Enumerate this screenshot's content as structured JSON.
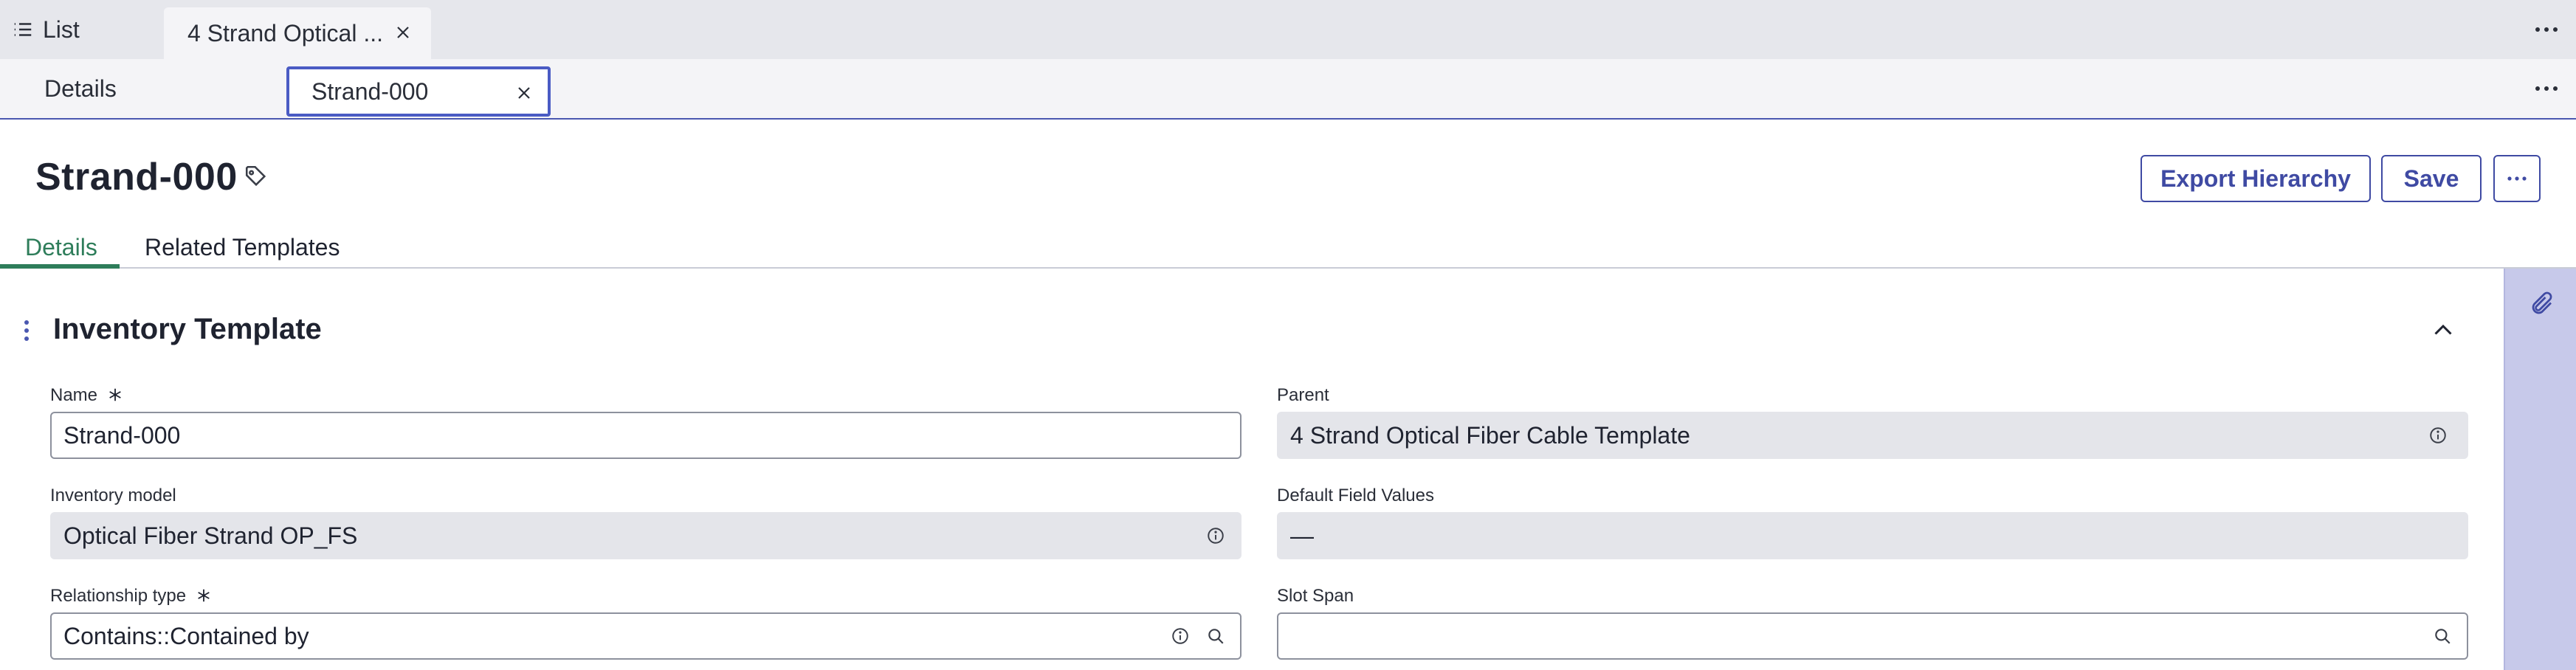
{
  "topbar": {
    "list_label": "List",
    "tab_label": "4 Strand Optical ...",
    "icons": [
      "list-icon",
      "close-icon",
      "more-icon"
    ]
  },
  "subbar": {
    "details_label": "Details",
    "tab_label": "Strand-000"
  },
  "header": {
    "title": "Strand-000",
    "buttons": {
      "export": "Export Hierarchy",
      "save": "Save",
      "more": "..."
    }
  },
  "record_tabs": [
    {
      "label": "Details",
      "active": true
    },
    {
      "label": "Related Templates",
      "active": false
    }
  ],
  "section": {
    "title": "Inventory Template",
    "fields": {
      "name": {
        "label": "Name",
        "value": "Strand-000",
        "required": true
      },
      "parent": {
        "label": "Parent",
        "value": "4 Strand Optical Fiber Cable Template"
      },
      "inventory_model": {
        "label": "Inventory model",
        "value": "Optical Fiber Strand OP_FS"
      },
      "default_field_values": {
        "label": "Default Field Values",
        "value": "—"
      },
      "relationship_type": {
        "label": "Relationship type",
        "value": "Contains::Contained by",
        "required": true
      },
      "slot_span": {
        "label": "Slot Span",
        "value": ""
      }
    }
  },
  "colors": {
    "accent": "#3f4aa3",
    "active_tab": "#2e7d5a",
    "rail": "#c7c9ea",
    "readonly_bg": "#e4e5ea"
  }
}
